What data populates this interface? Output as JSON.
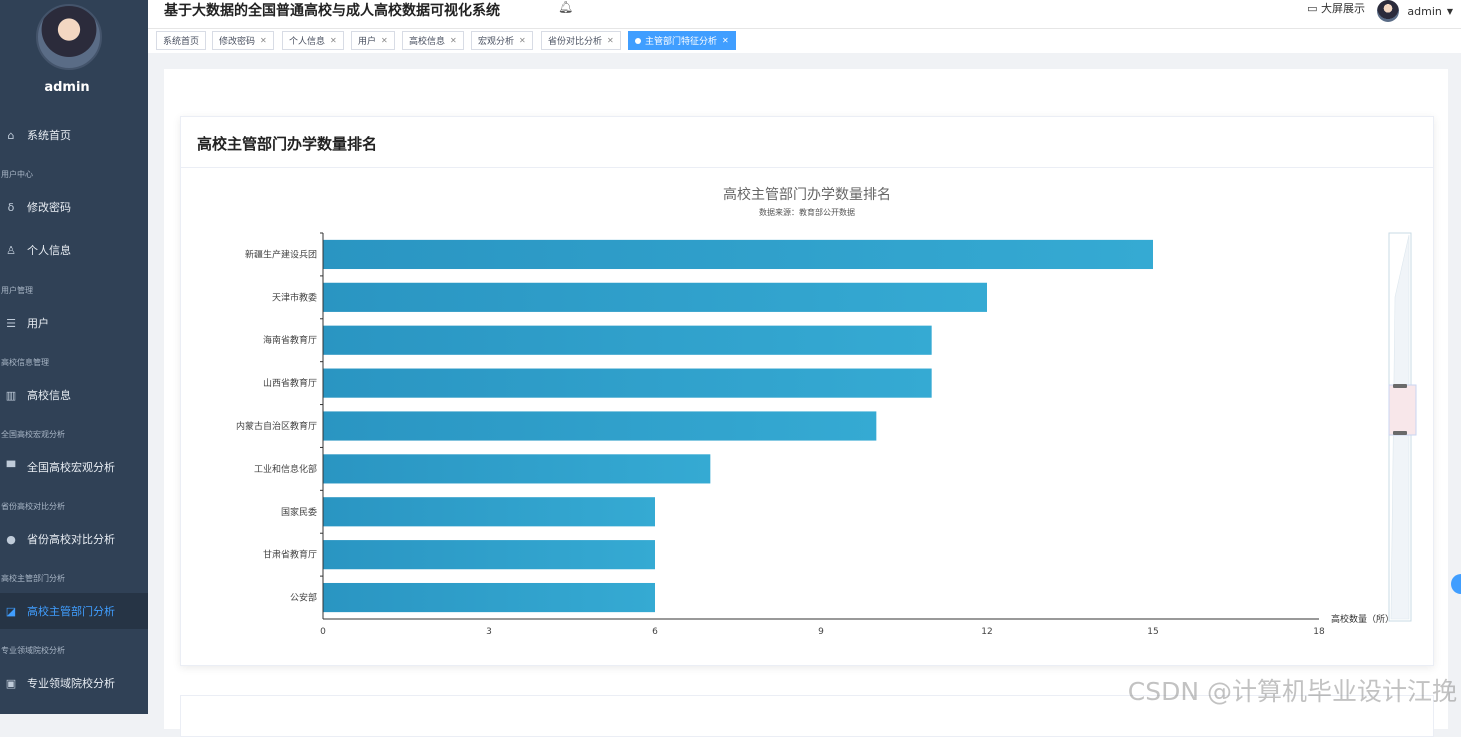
{
  "app": {
    "title": "基于大数据的全国普通高校与成人高校数据可视化系统"
  },
  "header": {
    "bigscreen_label": "大屏展示",
    "username": "admin"
  },
  "sidebar": {
    "username": "admin",
    "items": [
      {
        "label": "系统首页",
        "icon": "home-icon"
      },
      {
        "group": "用户中心",
        "label": "修改密码",
        "icon": "lock-icon"
      },
      {
        "label": "个人信息",
        "icon": "user-icon"
      },
      {
        "group": "用户管理",
        "label": "用户",
        "icon": "list-icon"
      },
      {
        "group": "高校信息管理",
        "label": "高校信息",
        "icon": "bar-chart-icon"
      },
      {
        "group": "全国高校宏观分析",
        "label": "全国高校宏观分析",
        "icon": "monitor-icon"
      },
      {
        "group": "省份高校对比分析",
        "label": "省份高校对比分析",
        "icon": "person-icon"
      },
      {
        "group": "高校主管部门分析",
        "label": "高校主管部门分析",
        "icon": "chart-icon",
        "active": true
      },
      {
        "group": "专业领域院校分析",
        "label": "专业领域院校分析",
        "icon": "doc-icon"
      }
    ]
  },
  "tags": [
    {
      "label": "系统首页",
      "closable": false
    },
    {
      "label": "修改密码",
      "closable": true
    },
    {
      "label": "个人信息",
      "closable": true
    },
    {
      "label": "用户",
      "closable": true
    },
    {
      "label": "高校信息",
      "closable": true
    },
    {
      "label": "宏观分析",
      "closable": true
    },
    {
      "label": "省份对比分析",
      "closable": true
    },
    {
      "label": "主管部门特征分析",
      "closable": true,
      "active": true
    }
  ],
  "card": {
    "title": "高校主管部门办学数量排名"
  },
  "chart_data": {
    "type": "bar",
    "orientation": "horizontal",
    "title": "高校主管部门办学数量排名",
    "subtitle": "数据来源：教育部公开数据",
    "xlabel": "高校数量（所）",
    "ylabel": "",
    "xlim": [
      0,
      18
    ],
    "xticks": [
      0,
      3,
      6,
      9,
      12,
      15,
      18
    ],
    "categories": [
      "新疆生产建设兵团",
      "天津市教委",
      "海南省教育厅",
      "山西省教育厅",
      "内蒙古自治区教育厅",
      "工业和信息化部",
      "国家民委",
      "甘肃省教育厅",
      "公安部"
    ],
    "values": [
      15,
      12,
      11,
      11,
      10,
      7,
      6,
      6,
      6
    ],
    "bar_color": "#2e9fca",
    "grid": false,
    "datazoom": "right"
  },
  "watermark": "CSDN @计算机毕业设计江挽"
}
